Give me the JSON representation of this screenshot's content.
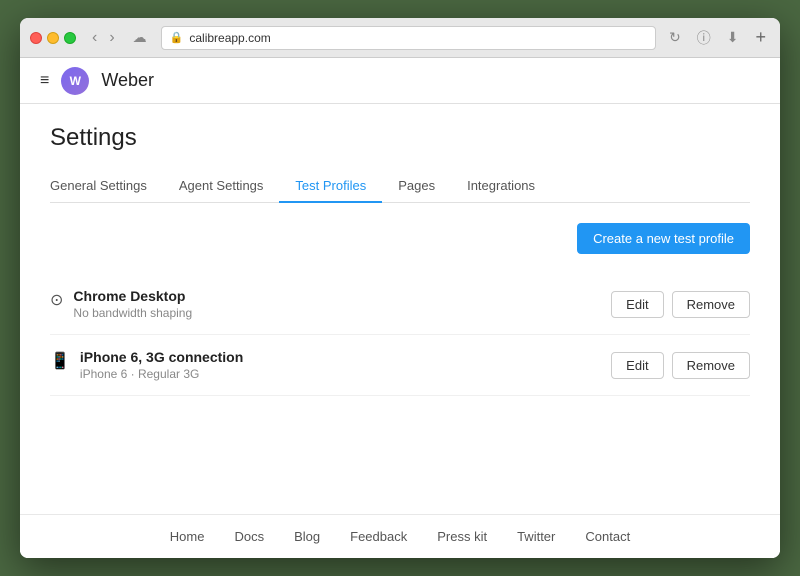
{
  "browser": {
    "url": "calibreapp.com",
    "url_display": "calibreapp.com"
  },
  "app": {
    "name": "Weber",
    "avatar_initials": "W"
  },
  "page": {
    "title": "Settings",
    "tabs": [
      {
        "id": "general",
        "label": "General Settings",
        "active": false
      },
      {
        "id": "agent",
        "label": "Agent Settings",
        "active": false
      },
      {
        "id": "test-profiles",
        "label": "Test Profiles",
        "active": true
      },
      {
        "id": "pages",
        "label": "Pages",
        "active": false
      },
      {
        "id": "integrations",
        "label": "Integrations",
        "active": false
      }
    ],
    "create_button_label": "Create a new test profile"
  },
  "profiles": [
    {
      "id": "chrome-desktop",
      "icon": "🖥",
      "icon_type": "desktop",
      "name": "Chrome Desktop",
      "detail": "No bandwidth shaping",
      "edit_label": "Edit",
      "remove_label": "Remove"
    },
    {
      "id": "iphone-6",
      "icon": "📱",
      "icon_type": "mobile",
      "name": "iPhone 6, 3G connection",
      "detail": "iPhone 6  ·  Regular 3G",
      "edit_label": "Edit",
      "remove_label": "Remove"
    }
  ],
  "footer": {
    "links": [
      {
        "id": "home",
        "label": "Home"
      },
      {
        "id": "docs",
        "label": "Docs"
      },
      {
        "id": "blog",
        "label": "Blog"
      },
      {
        "id": "feedback",
        "label": "Feedback"
      },
      {
        "id": "press-kit",
        "label": "Press kit"
      },
      {
        "id": "twitter",
        "label": "Twitter"
      },
      {
        "id": "contact",
        "label": "Contact"
      }
    ]
  }
}
